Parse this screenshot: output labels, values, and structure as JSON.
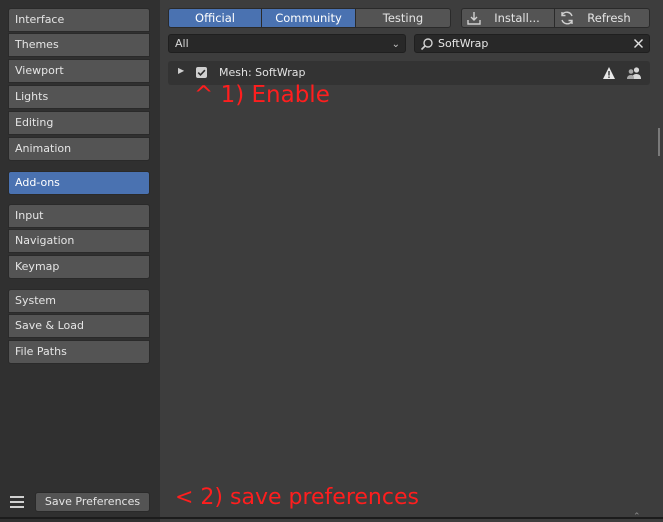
{
  "sidebar": {
    "items": [
      {
        "label": "Interface"
      },
      {
        "label": "Themes"
      },
      {
        "label": "Viewport"
      },
      {
        "label": "Lights"
      },
      {
        "label": "Editing"
      },
      {
        "label": "Animation"
      },
      {
        "label": "Add-ons",
        "active": true
      },
      {
        "label": "Input"
      },
      {
        "label": "Navigation"
      },
      {
        "label": "Keymap"
      },
      {
        "label": "System"
      },
      {
        "label": "Save & Load"
      },
      {
        "label": "File Paths"
      }
    ],
    "save_label": "Save Preferences"
  },
  "toolbar": {
    "tabs": [
      {
        "label": "Official",
        "selected": true
      },
      {
        "label": "Community",
        "selected": true
      },
      {
        "label": "Testing",
        "selected": false
      }
    ],
    "install_label": "Install...",
    "refresh_label": "Refresh"
  },
  "filter": {
    "category": "All",
    "search_value": "SoftWrap"
  },
  "addon": {
    "name": "Mesh: SoftWrap",
    "enabled": true
  },
  "annotations": {
    "enable": "^   1) Enable",
    "save": "< 2) save preferences"
  },
  "colors": {
    "accent": "#4a72b1",
    "annotation": "#ff1e1e",
    "background": "#3d3d3d",
    "sidebar": "#303030"
  },
  "icons": [
    "import-icon",
    "refresh-icon",
    "search-icon",
    "clear-icon",
    "warning-icon",
    "users-icon",
    "menu-icon",
    "disclosure-triangle-icon",
    "checkbox-icon",
    "chevron-down-icon"
  ]
}
